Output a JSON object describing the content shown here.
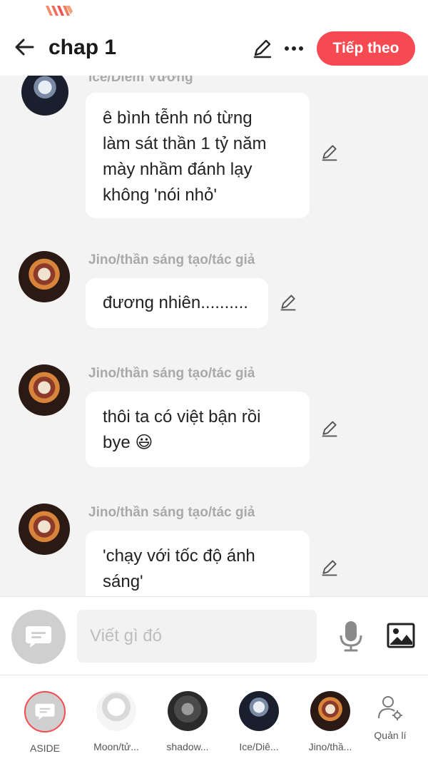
{
  "header": {
    "title": "chap 1",
    "next_label": "Tiếp theo"
  },
  "messages": [
    {
      "sender": "Ice/Diêm Vương",
      "text_lines": [
        "ê bình tễnh nó từng",
        "làm sát thần 1 tỷ năm",
        "mày nhầm đánh lạy",
        "không 'nói nhỏ'"
      ]
    },
    {
      "sender": "Jino/thần sáng tạo/tác giả",
      "text_lines": [
        "đương nhiên.........."
      ]
    },
    {
      "sender": "Jino/thần sáng tạo/tác giả",
      "text_lines": [
        "thôi ta có việt bận rồi",
        "bye 😃"
      ]
    },
    {
      "sender": "Jino/thần sáng tạo/tác giả",
      "text_lines": [
        "'chạy với tốc độ ánh",
        "sáng'"
      ]
    }
  ],
  "composer": {
    "placeholder": "Viết gì đó"
  },
  "bottombar": {
    "items": [
      {
        "label": "ASIDE"
      },
      {
        "label": "Moon/tử..."
      },
      {
        "label": "shadow..."
      },
      {
        "label": "Ice/Diê..."
      },
      {
        "label": "Jino/thầ..."
      },
      {
        "label": "Quản lí"
      }
    ]
  },
  "colors": {
    "accent": "#f64a52",
    "background": "#f3f3f3",
    "bubble": "#ffffff",
    "sender_text": "#a9a9a9"
  },
  "icons": {
    "back": "arrow-left-icon",
    "edit": "pencil-icon",
    "more": "more-dots-icon",
    "mic": "microphone-icon",
    "image": "image-icon",
    "aside": "chat-bubble-icon",
    "manage": "user-gear-icon"
  }
}
